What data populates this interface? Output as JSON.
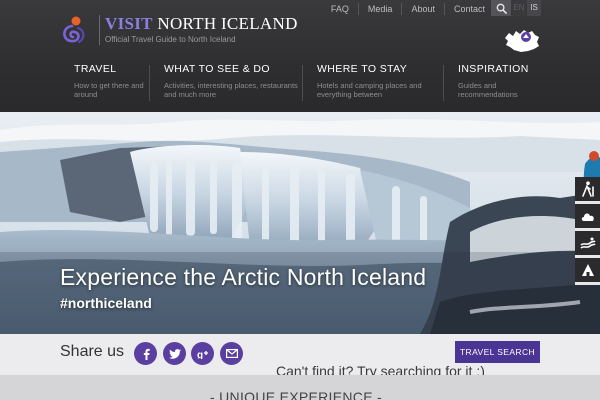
{
  "brand": {
    "name_accent": "VISIT",
    "name_rest": " NORTH ICELAND",
    "tagline": "Official Travel Guide to North Iceland"
  },
  "top_links": [
    "FAQ",
    "Media",
    "About",
    "Contact"
  ],
  "languages": [
    "EN",
    "IS"
  ],
  "nav": [
    {
      "title": "TRAVEL",
      "desc": "How to get there and around"
    },
    {
      "title": "WHAT TO SEE & DO",
      "desc": "Activities, interesting places, restaurants and much more"
    },
    {
      "title": "WHERE TO STAY",
      "desc": "Hotels and camping places and everything between"
    },
    {
      "title": "INSPIRATION",
      "desc": "Guides and recommendations"
    }
  ],
  "hero": {
    "title": "Experience the Arctic North Iceland",
    "hashtag": "#northiceland"
  },
  "side_tools": [
    "hiking-icon",
    "weather-icon",
    "road-conditions-icon",
    "info-icon"
  ],
  "share": {
    "label": "Share us",
    "networks": [
      "facebook-icon",
      "twitter-icon",
      "google-plus-icon",
      "email-icon"
    ]
  },
  "travel_search_label": "TRAVEL SEARCH",
  "cant_find_text": "Can't find it? Try searching for it :)",
  "section_heading": "- UNIQUE EXPERIENCE -",
  "colors": {
    "accent": "#4a3494",
    "brand_purple": "#8b7fe0",
    "header_bg": "#333335"
  }
}
